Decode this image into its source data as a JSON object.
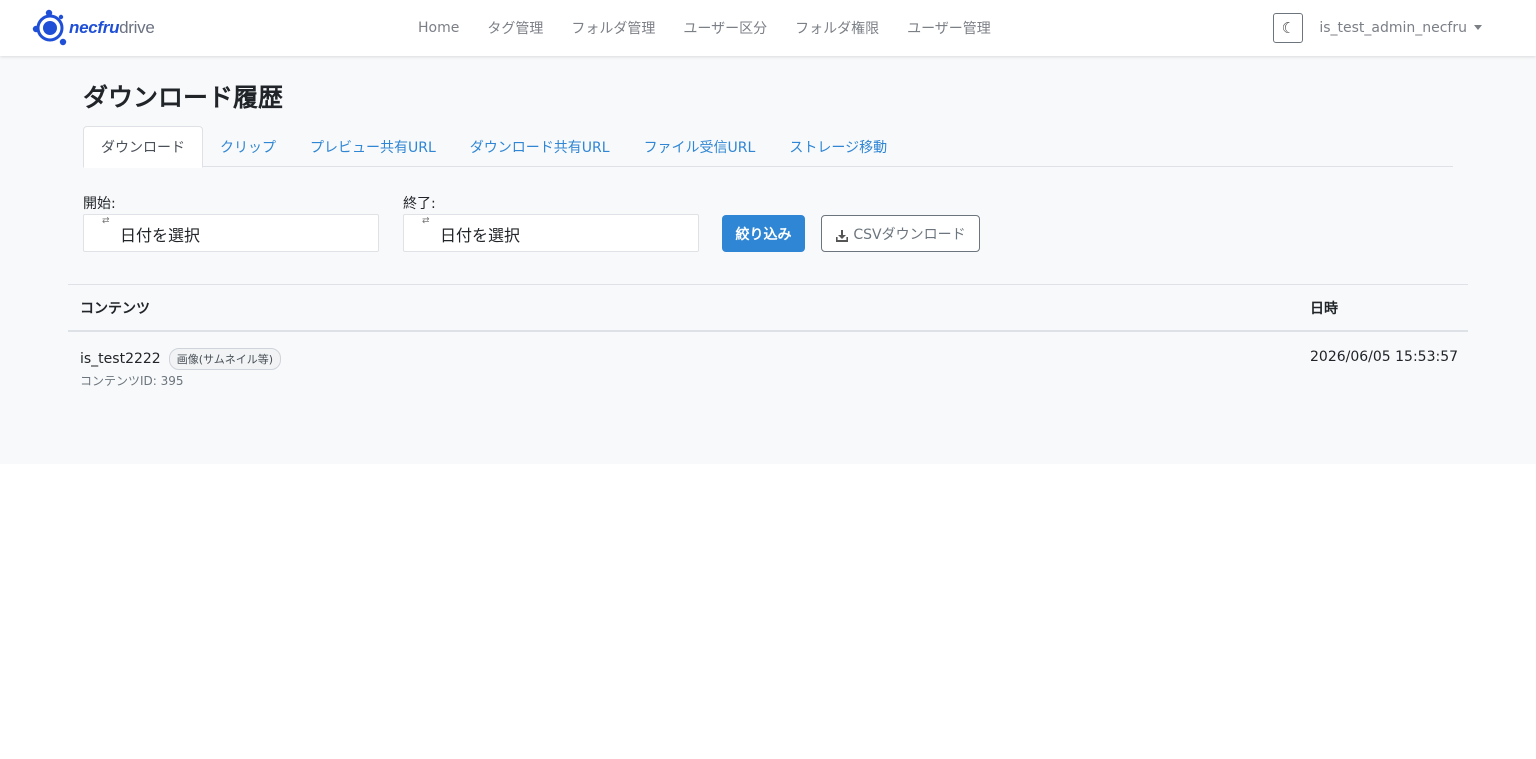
{
  "brand": {
    "strong": "necfru",
    "light": "drive",
    "logo_icon": "necfru-logo-icon",
    "color": "#1f4fd6"
  },
  "nav": {
    "links": [
      "Home",
      "タグ管理",
      "フォルダ管理",
      "ユーザー区分",
      "フォルダ権限",
      "ユーザー管理"
    ],
    "theme_toggle_icon": "moon-icon",
    "theme_toggle_glyph": "☾",
    "user": "is_test_admin_necfru"
  },
  "page": {
    "title": "ダウンロード履歴"
  },
  "tabs": [
    {
      "label": "ダウンロード",
      "active": true
    },
    {
      "label": "クリップ",
      "active": false
    },
    {
      "label": "プレビュー共有URL",
      "active": false
    },
    {
      "label": "ダウンロード共有URL",
      "active": false
    },
    {
      "label": "ファイル受信URL",
      "active": false
    },
    {
      "label": "ストレージ移動",
      "active": false
    }
  ],
  "filter": {
    "start_label": "開始:",
    "end_label": "終了:",
    "start_value": "日付を選択",
    "end_value": "日付を選択",
    "calendar_icon": "calendar-icon",
    "calendar_glyph": "⇄",
    "filter_button": "絞り込み",
    "csv_button": "CSVダウンロード",
    "csv_icon": "download-icon"
  },
  "table": {
    "columns": [
      "コンテンツ",
      "日時"
    ],
    "rows": [
      {
        "name": "is_test2222",
        "badge": "画像(サムネイル等)",
        "content_id": "コンテンツID: 395",
        "datetime": "2026/06/05 15:53:57"
      }
    ]
  },
  "colors": {
    "accent": "#2f86d4",
    "page_background": "#f8f9fa",
    "nav_text": "#7b7f86"
  }
}
